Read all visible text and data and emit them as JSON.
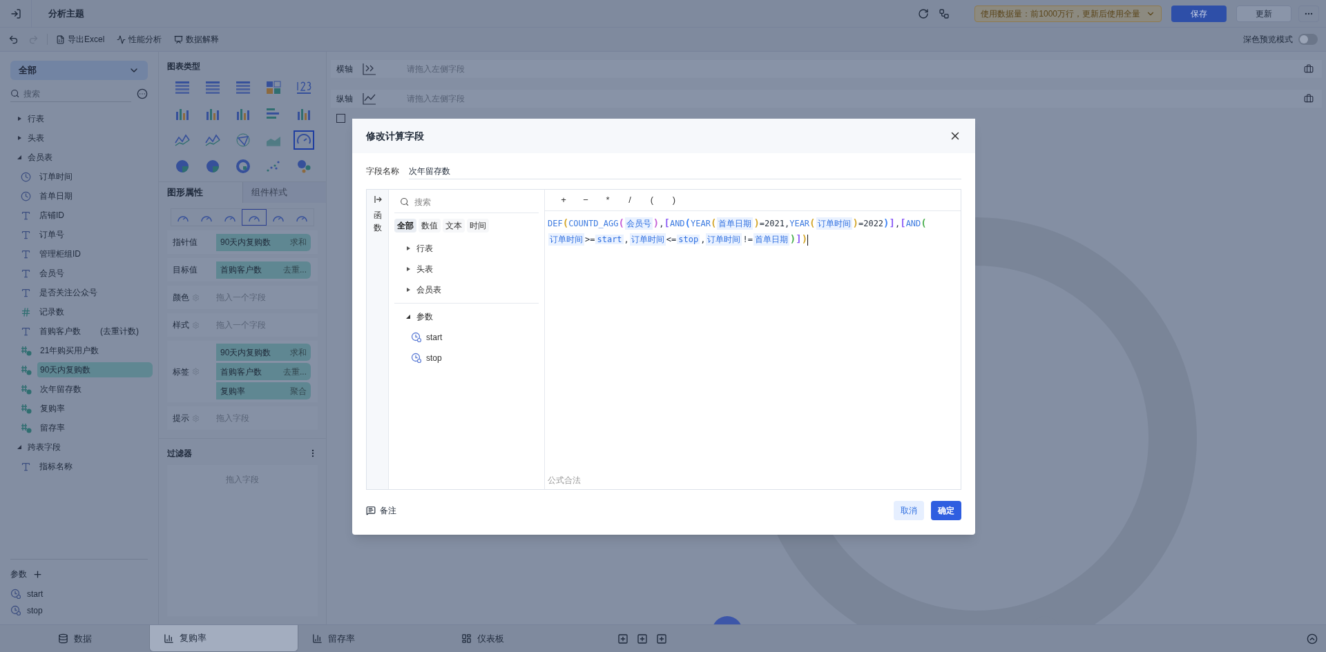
{
  "topbar": {
    "title": "分析主题",
    "notice": "使用数据量：前1000万行，更新后使用全量",
    "buttons": [
      {
        "label": "保存",
        "kind": "primary"
      },
      {
        "label": "更新",
        "kind": "default"
      }
    ]
  },
  "toolbar": {
    "actions": [
      {
        "label": "导出Excel",
        "kind": "excel"
      },
      {
        "label": "性能分析",
        "kind": "performance"
      },
      {
        "label": "数据解释",
        "kind": "explain"
      }
    ],
    "dark_preview": {
      "label": "深色预览模式",
      "on": false
    }
  },
  "sidebar": {
    "scope": "全部",
    "search_placeholder": "搜索",
    "tables": [
      {
        "name": "行表",
        "expanded": false
      },
      {
        "name": "头表",
        "expanded": false
      },
      {
        "name": "会员表",
        "expanded": true,
        "children": [
          {
            "name": "订单时间",
            "kind": "date",
            "selected": false
          },
          {
            "name": "首单日期",
            "kind": "date",
            "selected": false
          },
          {
            "name": "店铺ID",
            "kind": "text",
            "selected": false
          },
          {
            "name": "订单号",
            "kind": "text",
            "selected": false
          },
          {
            "name": "管理柜组ID",
            "kind": "text",
            "selected": false
          },
          {
            "name": "会员号",
            "kind": "text",
            "selected": false
          },
          {
            "name": "是否关注公众号",
            "kind": "text",
            "selected": false
          },
          {
            "name": "记录数",
            "kind": "count",
            "selected": false
          },
          {
            "name": "首购客户数",
            "kind": "text",
            "selected": false,
            "note": "(去重计数)"
          },
          {
            "name": "21年购买用户数",
            "kind": "calc",
            "selected": false
          },
          {
            "name": "90天内复购数",
            "kind": "calc",
            "selected": true
          },
          {
            "name": "次年留存数",
            "kind": "calc",
            "selected": false
          },
          {
            "name": "复购率",
            "kind": "calc",
            "selected": false
          },
          {
            "name": "留存率",
            "kind": "calc",
            "selected": false
          }
        ]
      },
      {
        "name": "跨表字段",
        "expanded": true,
        "children": [
          {
            "name": "指标名称",
            "kind": "cross",
            "selected": false
          }
        ]
      }
    ],
    "params_title": "参数",
    "params": [
      {
        "name": "start"
      },
      {
        "name": "stop"
      }
    ]
  },
  "chart_panel": {
    "title": "图表类型",
    "chart_types": [
      {
        "kind": "table",
        "selected": false
      },
      {
        "kind": "table",
        "selected": false
      },
      {
        "kind": "table",
        "selected": false
      },
      {
        "kind": "block",
        "selected": false
      },
      {
        "kind": "number",
        "selected": false
      },
      {
        "kind": "bar",
        "selected": false
      },
      {
        "kind": "bar",
        "selected": false
      },
      {
        "kind": "bar",
        "selected": false
      },
      {
        "kind": "hbar",
        "selected": false
      },
      {
        "kind": "bar",
        "selected": false
      },
      {
        "kind": "line",
        "selected": false
      },
      {
        "kind": "line",
        "selected": false
      },
      {
        "kind": "radar",
        "selected": false
      },
      {
        "kind": "area",
        "selected": false
      },
      {
        "kind": "gauge",
        "selected": true
      },
      {
        "kind": "pie",
        "selected": false
      },
      {
        "kind": "pie",
        "selected": false
      },
      {
        "kind": "ring",
        "selected": false
      },
      {
        "kind": "scatter",
        "selected": false
      },
      {
        "kind": "bubble",
        "selected": false
      }
    ],
    "tabs": [
      {
        "label": "图形属性",
        "selected": true
      },
      {
        "label": "组件样式",
        "selected": false
      }
    ],
    "gauge_styles": [
      {
        "selected": false
      },
      {
        "selected": false
      },
      {
        "selected": false
      },
      {
        "selected": true
      },
      {
        "selected": false
      },
      {
        "selected": false
      }
    ],
    "properties": [
      {
        "label": "指针值",
        "gear": false,
        "fields": [
          {
            "name": "90天内复购数",
            "aggregation": "求和"
          }
        ]
      },
      {
        "label": "目标值",
        "gear": false,
        "fields": [
          {
            "name": "首购客户数",
            "aggregation": "去重..."
          }
        ]
      },
      {
        "label": "颜色",
        "gear": true,
        "placeholder": "拖入一个字段"
      },
      {
        "label": "样式",
        "gear": true,
        "placeholder": "拖入一个字段"
      },
      {
        "label": "标签",
        "gear": true,
        "fields": [
          {
            "name": "90天内复购数",
            "aggregation": "求和"
          },
          {
            "name": "首购客户数",
            "aggregation": "去重..."
          },
          {
            "name": "复购率",
            "aggregation": "聚合"
          }
        ]
      },
      {
        "label": "提示",
        "gear": true,
        "placeholder": "拖入字段"
      }
    ],
    "filter": {
      "title": "过滤器",
      "placeholder": "拖入字段"
    }
  },
  "axes": [
    {
      "label": "横轴",
      "kind": "x",
      "placeholder": "请拖入左侧字段"
    },
    {
      "label": "纵轴",
      "kind": "y",
      "placeholder": "请拖入左侧字段"
    }
  ],
  "manual_preview": {
    "checked": false
  },
  "dialog": {
    "title": "修改计算字段",
    "name_label": "字段名称",
    "name_value": "次年留存数",
    "side_label": "函数",
    "search_placeholder": "搜索",
    "filter_tabs": [
      {
        "label": "全部",
        "selected": true
      },
      {
        "label": "数值",
        "selected": false
      },
      {
        "label": "文本",
        "selected": false
      },
      {
        "label": "时间",
        "selected": false
      }
    ],
    "tables": [
      {
        "name": "行表",
        "expanded": false
      },
      {
        "name": "头表",
        "expanded": false
      },
      {
        "name": "会员表",
        "expanded": false
      }
    ],
    "params": {
      "name": "参数",
      "expanded": true,
      "children": [
        {
          "name": "start"
        },
        {
          "name": "stop"
        }
      ]
    },
    "operators": [
      "+",
      "−",
      "*",
      "/",
      "(",
      ")"
    ],
    "formula": [
      {
        "kind": "func",
        "text": "DEF"
      },
      {
        "kind": "bracket",
        "text": "(",
        "color": "#d4a72c"
      },
      {
        "kind": "func",
        "text": "COUNTD_AGG"
      },
      {
        "kind": "bracket",
        "text": "(",
        "color": "#c55fd6"
      },
      {
        "kind": "field",
        "text": "会员号"
      },
      {
        "kind": "bracket",
        "text": ")",
        "color": "#c55fd6"
      },
      {
        "kind": "op",
        "text": ","
      },
      {
        "kind": "bracket",
        "text": "[",
        "color": "#8b5cf6"
      },
      {
        "kind": "func",
        "text": "AND"
      },
      {
        "kind": "bracket",
        "text": "(",
        "color": "#3b82f6"
      },
      {
        "kind": "func",
        "text": "YEAR"
      },
      {
        "kind": "bracket",
        "text": "(",
        "color": "#d4a72c"
      },
      {
        "kind": "field",
        "text": "首单日期"
      },
      {
        "kind": "bracket",
        "text": ")",
        "color": "#d4a72c"
      },
      {
        "kind": "op",
        "text": "=2021,"
      },
      {
        "kind": "func",
        "text": "YEAR"
      },
      {
        "kind": "bracket",
        "text": "(",
        "color": "#d4a72c"
      },
      {
        "kind": "field",
        "text": "订单时间"
      },
      {
        "kind": "bracket",
        "text": ")",
        "color": "#d4a72c"
      },
      {
        "kind": "op",
        "text": "=2022"
      },
      {
        "kind": "bracket",
        "text": ")",
        "color": "#3b82f6"
      },
      {
        "kind": "bracket",
        "text": "]",
        "color": "#8b5cf6"
      },
      {
        "kind": "op",
        "text": ","
      },
      {
        "kind": "bracket",
        "text": "[",
        "color": "#8b5cf6"
      },
      {
        "kind": "func",
        "text": "AND"
      },
      {
        "kind": "bracket",
        "text": "(",
        "color": "#4caf50"
      },
      {
        "kind": "field",
        "text": "订单时间"
      },
      {
        "kind": "op",
        "text": ">="
      },
      {
        "kind": "param",
        "text": "start"
      },
      {
        "kind": "op",
        "text": ","
      },
      {
        "kind": "field",
        "text": "订单时间"
      },
      {
        "kind": "op",
        "text": "<="
      },
      {
        "kind": "param",
        "text": "stop"
      },
      {
        "kind": "op",
        "text": ","
      },
      {
        "kind": "field",
        "text": "订单时间"
      },
      {
        "kind": "op",
        "text": "!="
      },
      {
        "kind": "field",
        "text": "首单日期"
      },
      {
        "kind": "bracket",
        "text": ")",
        "color": "#4caf50"
      },
      {
        "kind": "bracket",
        "text": "]",
        "color": "#8b5cf6"
      },
      {
        "kind": "bracket",
        "text": ")",
        "color": "#d4a72c"
      }
    ],
    "status": "公式合法",
    "note": "备注",
    "cancel": "取消",
    "confirm": "确定"
  },
  "bottom_tabs": [
    {
      "label": "数据",
      "kind": "data",
      "selected": false
    },
    {
      "label": "复购率",
      "kind": "chart",
      "selected": true
    },
    {
      "label": "留存率",
      "kind": "chart",
      "selected": false
    },
    {
      "label": "仪表板",
      "kind": "dashboard",
      "selected": false
    }
  ]
}
